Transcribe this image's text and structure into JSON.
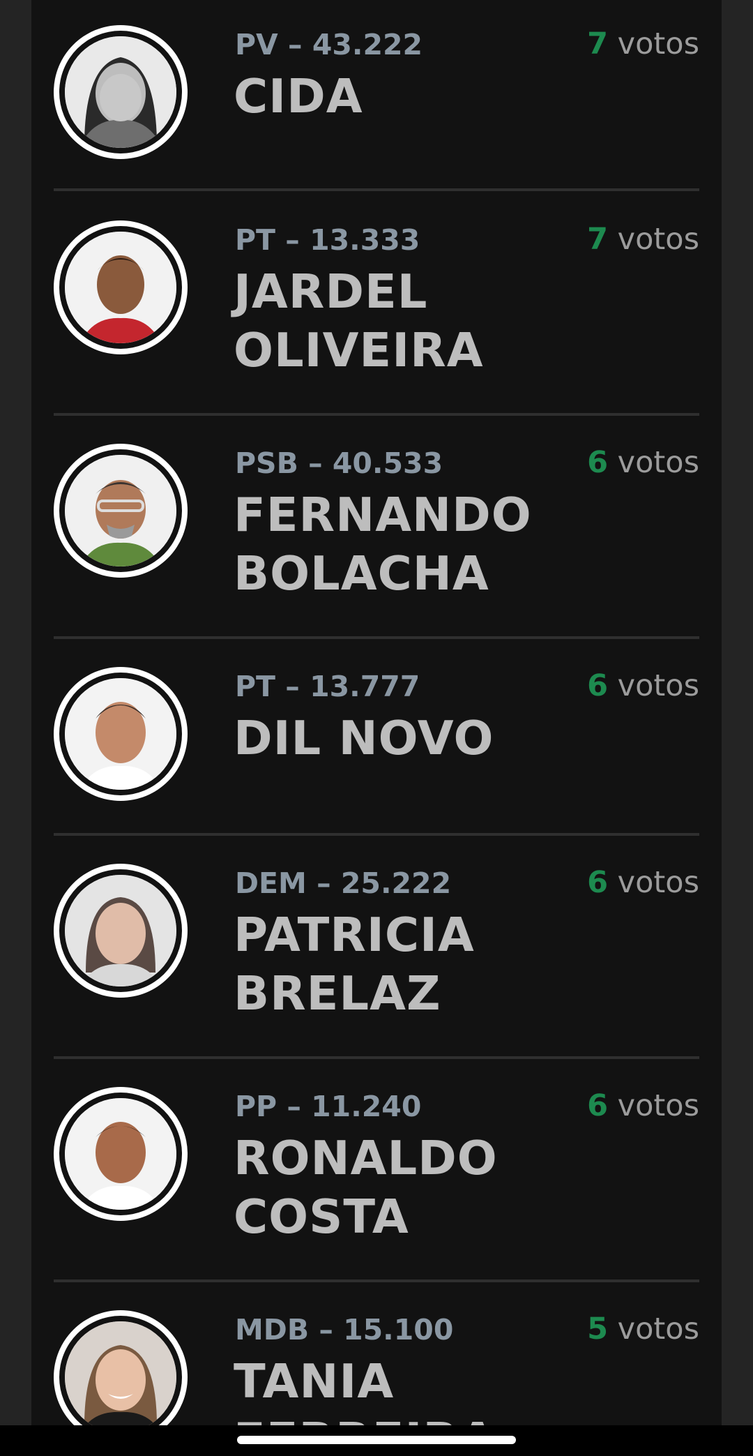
{
  "candidates": [
    {
      "party": "PV – 43.222",
      "name": "CIDA",
      "vote_count": "7",
      "vote_label": "votos",
      "photo": "woman-portrait-grayscale"
    },
    {
      "party": "PT – 13.333",
      "name": "JARDEL OLIVEIRA",
      "vote_count": "7",
      "vote_label": "votos",
      "photo": "man-portrait-red-shirt"
    },
    {
      "party": "PSB – 40.533",
      "name": "FERNANDO BOLACHA",
      "vote_count": "6",
      "vote_label": "votos",
      "photo": "man-portrait-glasses-green-shirt"
    },
    {
      "party": "PT – 13.777",
      "name": "DIL NOVO",
      "vote_count": "6",
      "vote_label": "votos",
      "photo": "man-portrait-white-shirt"
    },
    {
      "party": "DEM – 25.222",
      "name": "PATRICIA BRELAZ",
      "vote_count": "6",
      "vote_label": "votos",
      "photo": "woman-portrait-faded"
    },
    {
      "party": "PP – 11.240",
      "name": "RONALDO COSTA",
      "vote_count": "6",
      "vote_label": "votos",
      "photo": "man-portrait-white-shirt"
    },
    {
      "party": "MDB – 15.100",
      "name": "TANIA FERREIRA",
      "vote_count": "5",
      "vote_label": "votos",
      "photo": "woman-portrait-smiling"
    }
  ],
  "colors": {
    "page_background": "#242424",
    "panel_background": "#121212",
    "party_text": "#8a97a3",
    "name_text": "#bdbdbd",
    "vote_count": "#1d8a4f",
    "vote_label": "#9c9c9c",
    "divider": "#2f2f2f"
  }
}
